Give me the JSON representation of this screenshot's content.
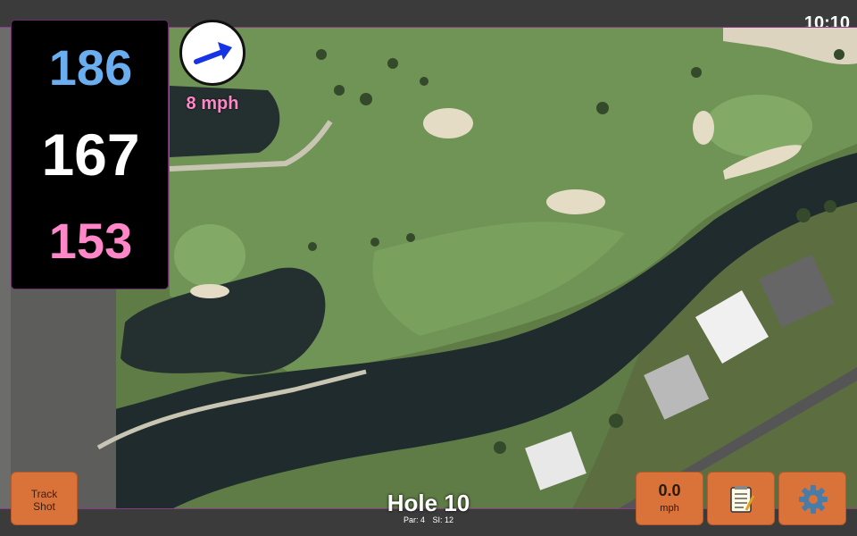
{
  "status_bar": {
    "time": "10:10"
  },
  "distances": {
    "back": "186",
    "middle": "167",
    "front": "153"
  },
  "wind": {
    "speed_label": "8 mph",
    "arrow_icon": "arrow-right-icon"
  },
  "hole": {
    "title": "Hole 10",
    "par": "Par: 4",
    "stroke_index": "SI: 12"
  },
  "buttons": {
    "track_shot_line1": "Track",
    "track_shot_line2": "Shot",
    "speed_value": "0.0",
    "speed_unit": "mph",
    "notes_icon": "notepad-icon",
    "settings_icon": "gear-icon"
  },
  "colors": {
    "back_distance": "#6aaef0",
    "middle_distance": "#ffffff",
    "front_distance": "#ff86c8",
    "button_orange": "#d9733a",
    "wind_arrow": "#1733e6"
  }
}
